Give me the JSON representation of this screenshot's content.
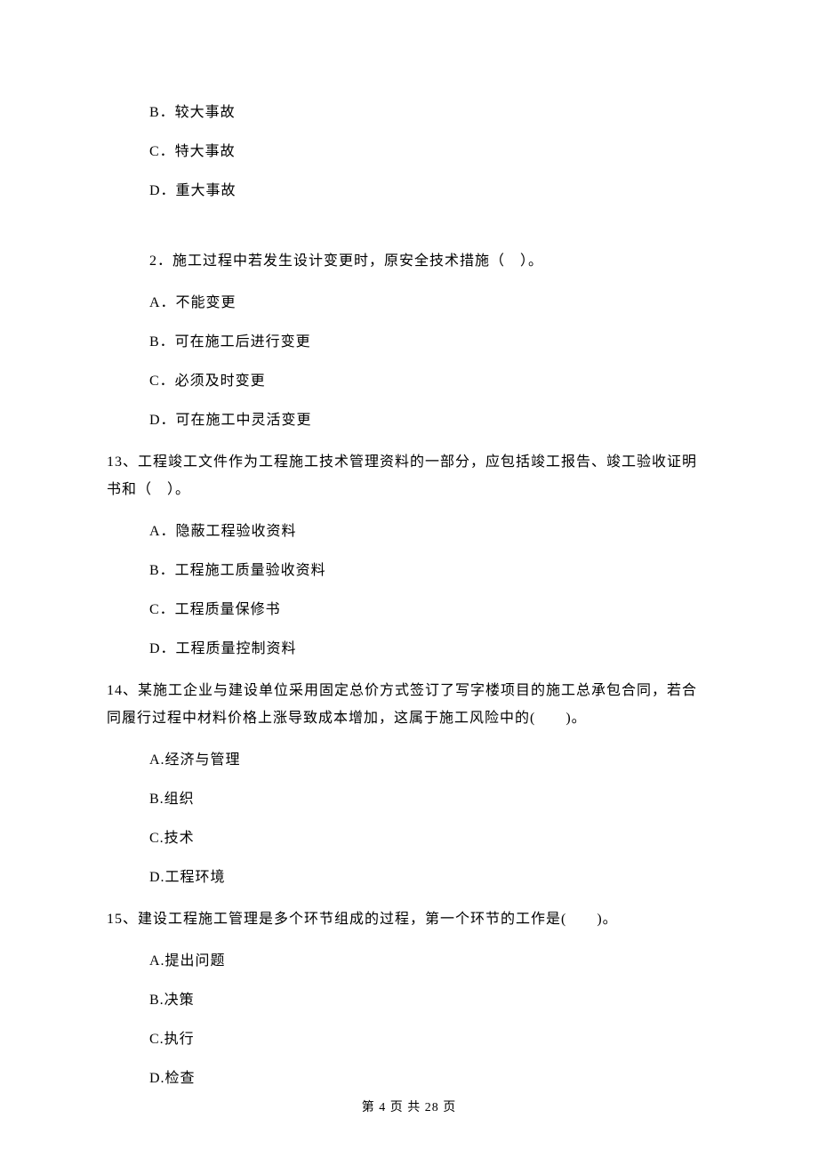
{
  "q_prev_options": {
    "b": "B．较大事故",
    "c": "C．特大事故",
    "d": "D．重大事故"
  },
  "q2": {
    "text": "2．施工过程中若发生设计变更时，原安全技术措施（　）。",
    "options": {
      "a": "A．不能变更",
      "b": "B．可在施工后进行变更",
      "c": "C．必须及时变更",
      "d": "D．可在施工中灵活变更"
    }
  },
  "q13": {
    "text": "13、工程竣工文件作为工程施工技术管理资料的一部分，应包括竣工报告、竣工验收证明书和（　）。",
    "options": {
      "a": "A．隐蔽工程验收资料",
      "b": "B．工程施工质量验收资料",
      "c": "C．工程质量保修书",
      "d": "D．工程质量控制资料"
    }
  },
  "q14": {
    "text": "14、某施工企业与建设单位采用固定总价方式签订了写字楼项目的施工总承包合同，若合同履行过程中材料价格上涨导致成本增加，这属于施工风险中的(　　)。",
    "options": {
      "a": "A.经济与管理",
      "b": "B.组织",
      "c": "C.技术",
      "d": "D.工程环境"
    }
  },
  "q15": {
    "text": "15、建设工程施工管理是多个环节组成的过程，第一个环节的工作是(　　)。",
    "options": {
      "a": "A.提出问题",
      "b": "B.决策",
      "c": "C.执行",
      "d": "D.检查"
    }
  },
  "footer": "第 4 页 共 28 页"
}
